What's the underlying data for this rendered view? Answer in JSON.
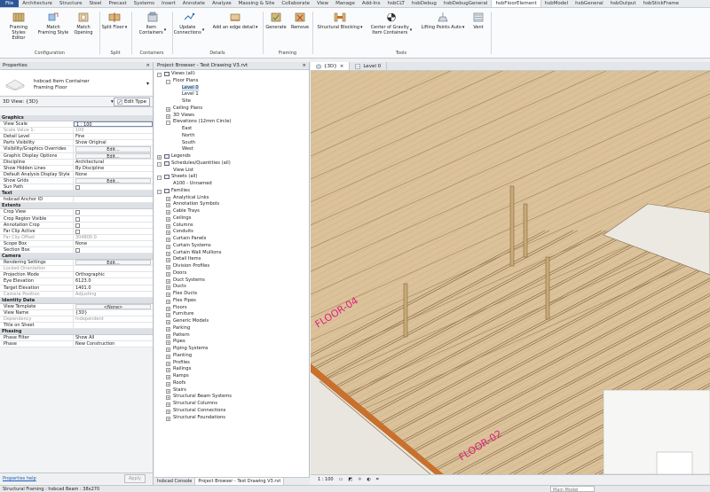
{
  "ribbon": {
    "tabs": [
      "File",
      "Architecture",
      "Structure",
      "Steel",
      "Precast",
      "Systems",
      "Insert",
      "Annotate",
      "Analyze",
      "Massing & Site",
      "Collaborate",
      "View",
      "Manage",
      "Add-Ins",
      "hsbCLT",
      "hsbDebug",
      "hsbDebugGeneral",
      "hsbFloorElement",
      "hsbModel",
      "hsbGeneral",
      "hsbOutput",
      "hsbStickFrame"
    ],
    "active_tab": "hsbFloorElement",
    "buttons": {
      "framing_styles_editor": "Framing Styles\nEditor",
      "match_framing_style": "Match\nFraming Style",
      "match_opening": "Match\nOpening",
      "split_floor": "Split Floor",
      "item_containers": "Item\nContainers",
      "update_connections": "Update\nConnections",
      "add_edge_detail": "Add an edge detail",
      "generate": "Generate",
      "remove": "Remove",
      "structural_blocking": "Structural Blocking",
      "center_of_gravity": "Center of Gravity\nItem Containers",
      "lifting_points_auto": "Lifting Points Auto",
      "vent": "Vent"
    },
    "panels": {
      "configuration": "Configuration",
      "split": "Split",
      "containers": "Containers",
      "details": "Details",
      "framing": "Framing",
      "tools": "Tools"
    }
  },
  "properties": {
    "title": "Properties",
    "close": "×",
    "type_name_1": "hsbcad Item Container",
    "type_name_2": "Framing Floor",
    "view_selector": "3D View: {3D}",
    "edit_type": "Edit Type",
    "sections": [
      {
        "name": "Graphics",
        "rows": [
          {
            "k": "View Scale",
            "v": "1 : 100",
            "kind": "box"
          },
          {
            "k": "Scale Value    1:",
            "v": "100",
            "kind": "dim"
          },
          {
            "k": "Detail Level",
            "v": "Fine"
          },
          {
            "k": "Parts Visibility",
            "v": "Show Original"
          },
          {
            "k": "Visibility/Graphics Overrides",
            "v": "Edit...",
            "kind": "btn"
          },
          {
            "k": "Graphic Display Options",
            "v": "Edit...",
            "kind": "btn"
          },
          {
            "k": "Discipline",
            "v": "Architectural"
          },
          {
            "k": "Show Hidden Lines",
            "v": "By Discipline"
          },
          {
            "k": "Default Analysis Display Style",
            "v": "None"
          },
          {
            "k": "Show Grids",
            "v": "Edit...",
            "kind": "btn"
          },
          {
            "k": "Sun Path",
            "v": "",
            "kind": "cb"
          }
        ]
      },
      {
        "name": "Text",
        "rows": [
          {
            "k": "hsbcad Anchor ID",
            "v": ""
          }
        ]
      },
      {
        "name": "Extents",
        "rows": [
          {
            "k": "Crop View",
            "v": "",
            "kind": "cb"
          },
          {
            "k": "Crop Region Visible",
            "v": "",
            "kind": "cb"
          },
          {
            "k": "Annotation Crop",
            "v": "",
            "kind": "cb"
          },
          {
            "k": "Far Clip Active",
            "v": "",
            "kind": "cb"
          },
          {
            "k": "Far Clip Offset",
            "v": "304800.0",
            "kind": "dim"
          },
          {
            "k": "Scope Box",
            "v": "None"
          },
          {
            "k": "Section Box",
            "v": "",
            "kind": "cb"
          }
        ]
      },
      {
        "name": "Camera",
        "rows": [
          {
            "k": "Rendering Settings",
            "v": "Edit...",
            "kind": "btn"
          },
          {
            "k": "Locked Orientation",
            "v": "",
            "kind": "dim"
          },
          {
            "k": "Projection Mode",
            "v": "Orthographic"
          },
          {
            "k": "Eye Elevation",
            "v": "6123.0"
          },
          {
            "k": "Target Elevation",
            "v": "1401.0"
          },
          {
            "k": "Camera Position",
            "v": "Adjusting",
            "kind": "dim"
          }
        ]
      },
      {
        "name": "Identity Data",
        "rows": [
          {
            "k": "View Template",
            "v": "<None>",
            "kind": "btn"
          },
          {
            "k": "View Name",
            "v": "{3D}"
          },
          {
            "k": "Dependency",
            "v": "Independent",
            "kind": "dim"
          },
          {
            "k": "Title on Sheet",
            "v": ""
          }
        ]
      },
      {
        "name": "Phasing",
        "rows": [
          {
            "k": "Phase Filter",
            "v": "Show All"
          },
          {
            "k": "Phase",
            "v": "New Construction"
          }
        ]
      }
    ],
    "help_link": "Properties help",
    "apply": "Apply"
  },
  "browser": {
    "title": "Project Browser - Test Drawing V3.rvt",
    "close": "×",
    "tree": [
      {
        "label": "Views (all)",
        "level": 0,
        "exp": "-"
      },
      {
        "label": "Floor Plans",
        "level": 1,
        "exp": "-"
      },
      {
        "label": "Level 0",
        "level": 2,
        "sel": true
      },
      {
        "label": "Level 1",
        "level": 2
      },
      {
        "label": "Site",
        "level": 2
      },
      {
        "label": "Ceiling Plans",
        "level": 1,
        "exp": "+"
      },
      {
        "label": "3D Views",
        "level": 1,
        "exp": "+"
      },
      {
        "label": "Elevations (12mm Circle)",
        "level": 1,
        "exp": "-"
      },
      {
        "label": "East",
        "level": 2
      },
      {
        "label": "North",
        "level": 2
      },
      {
        "label": "South",
        "level": 2
      },
      {
        "label": "West",
        "level": 2
      },
      {
        "label": "Legends",
        "level": 0,
        "exp": "+",
        "icon": true
      },
      {
        "label": "Schedules/Quantities (all)",
        "level": 0,
        "exp": "-",
        "icon": true
      },
      {
        "label": "View List",
        "level": 1
      },
      {
        "label": "Sheets (all)",
        "level": 0,
        "exp": "-",
        "icon": true
      },
      {
        "label": "A100 - Unnamed",
        "level": 1
      },
      {
        "label": "Families",
        "level": 0,
        "exp": "-",
        "icon": true
      },
      {
        "label": "Analytical Links",
        "level": 1,
        "exp": "+"
      },
      {
        "label": "Annotation Symbols",
        "level": 1,
        "exp": "+"
      },
      {
        "label": "Cable Trays",
        "level": 1,
        "exp": "+"
      },
      {
        "label": "Ceilings",
        "level": 1,
        "exp": "+"
      },
      {
        "label": "Columns",
        "level": 1,
        "exp": "+"
      },
      {
        "label": "Conduits",
        "level": 1,
        "exp": "+"
      },
      {
        "label": "Curtain Panels",
        "level": 1,
        "exp": "+"
      },
      {
        "label": "Curtain Systems",
        "level": 1,
        "exp": "+"
      },
      {
        "label": "Curtain Wall Mullions",
        "level": 1,
        "exp": "+"
      },
      {
        "label": "Detail Items",
        "level": 1,
        "exp": "+"
      },
      {
        "label": "Division Profiles",
        "level": 1,
        "exp": "+"
      },
      {
        "label": "Doors",
        "level": 1,
        "exp": "+"
      },
      {
        "label": "Duct Systems",
        "level": 1,
        "exp": "+"
      },
      {
        "label": "Ducts",
        "level": 1,
        "exp": "+"
      },
      {
        "label": "Flex Ducts",
        "level": 1,
        "exp": "+"
      },
      {
        "label": "Flex Pipes",
        "level": 1,
        "exp": "+"
      },
      {
        "label": "Floors",
        "level": 1,
        "exp": "+"
      },
      {
        "label": "Furniture",
        "level": 1,
        "exp": "+"
      },
      {
        "label": "Generic Models",
        "level": 1,
        "exp": "+"
      },
      {
        "label": "Parking",
        "level": 1,
        "exp": "+"
      },
      {
        "label": "Pattern",
        "level": 1,
        "exp": "+"
      },
      {
        "label": "Pipes",
        "level": 1,
        "exp": "+"
      },
      {
        "label": "Piping Systems",
        "level": 1,
        "exp": "+"
      },
      {
        "label": "Planting",
        "level": 1,
        "exp": "+"
      },
      {
        "label": "Profiles",
        "level": 1,
        "exp": "+"
      },
      {
        "label": "Railings",
        "level": 1,
        "exp": "+"
      },
      {
        "label": "Ramps",
        "level": 1,
        "exp": "+"
      },
      {
        "label": "Roofs",
        "level": 1,
        "exp": "+"
      },
      {
        "label": "Stairs",
        "level": 1,
        "exp": "+"
      },
      {
        "label": "Structural Beam Systems",
        "level": 1,
        "exp": "+"
      },
      {
        "label": "Structural Columns",
        "level": 1,
        "exp": "+"
      },
      {
        "label": "Structural Connections",
        "level": 1,
        "exp": "+"
      },
      {
        "label": "Structural Foundations",
        "level": 1,
        "exp": "+"
      }
    ],
    "bottom_tabs": [
      "hsbcad Console",
      "Project Browser - Test Drawing V3.rvt"
    ]
  },
  "view": {
    "tabs": [
      {
        "label": "{3D}",
        "active": true,
        "close": "×"
      },
      {
        "label": "Level 0",
        "active": false
      }
    ],
    "labels": [
      "FLOOR-04",
      "FLOOR-02"
    ],
    "scale": "1 : 100",
    "colors": {
      "label": "#e0207e",
      "timber": "#dcc29a",
      "rim": "#c8702e"
    }
  },
  "status": {
    "text": "Structural Framing : hsbcad Beam : 38x270",
    "model": "Main Model"
  }
}
